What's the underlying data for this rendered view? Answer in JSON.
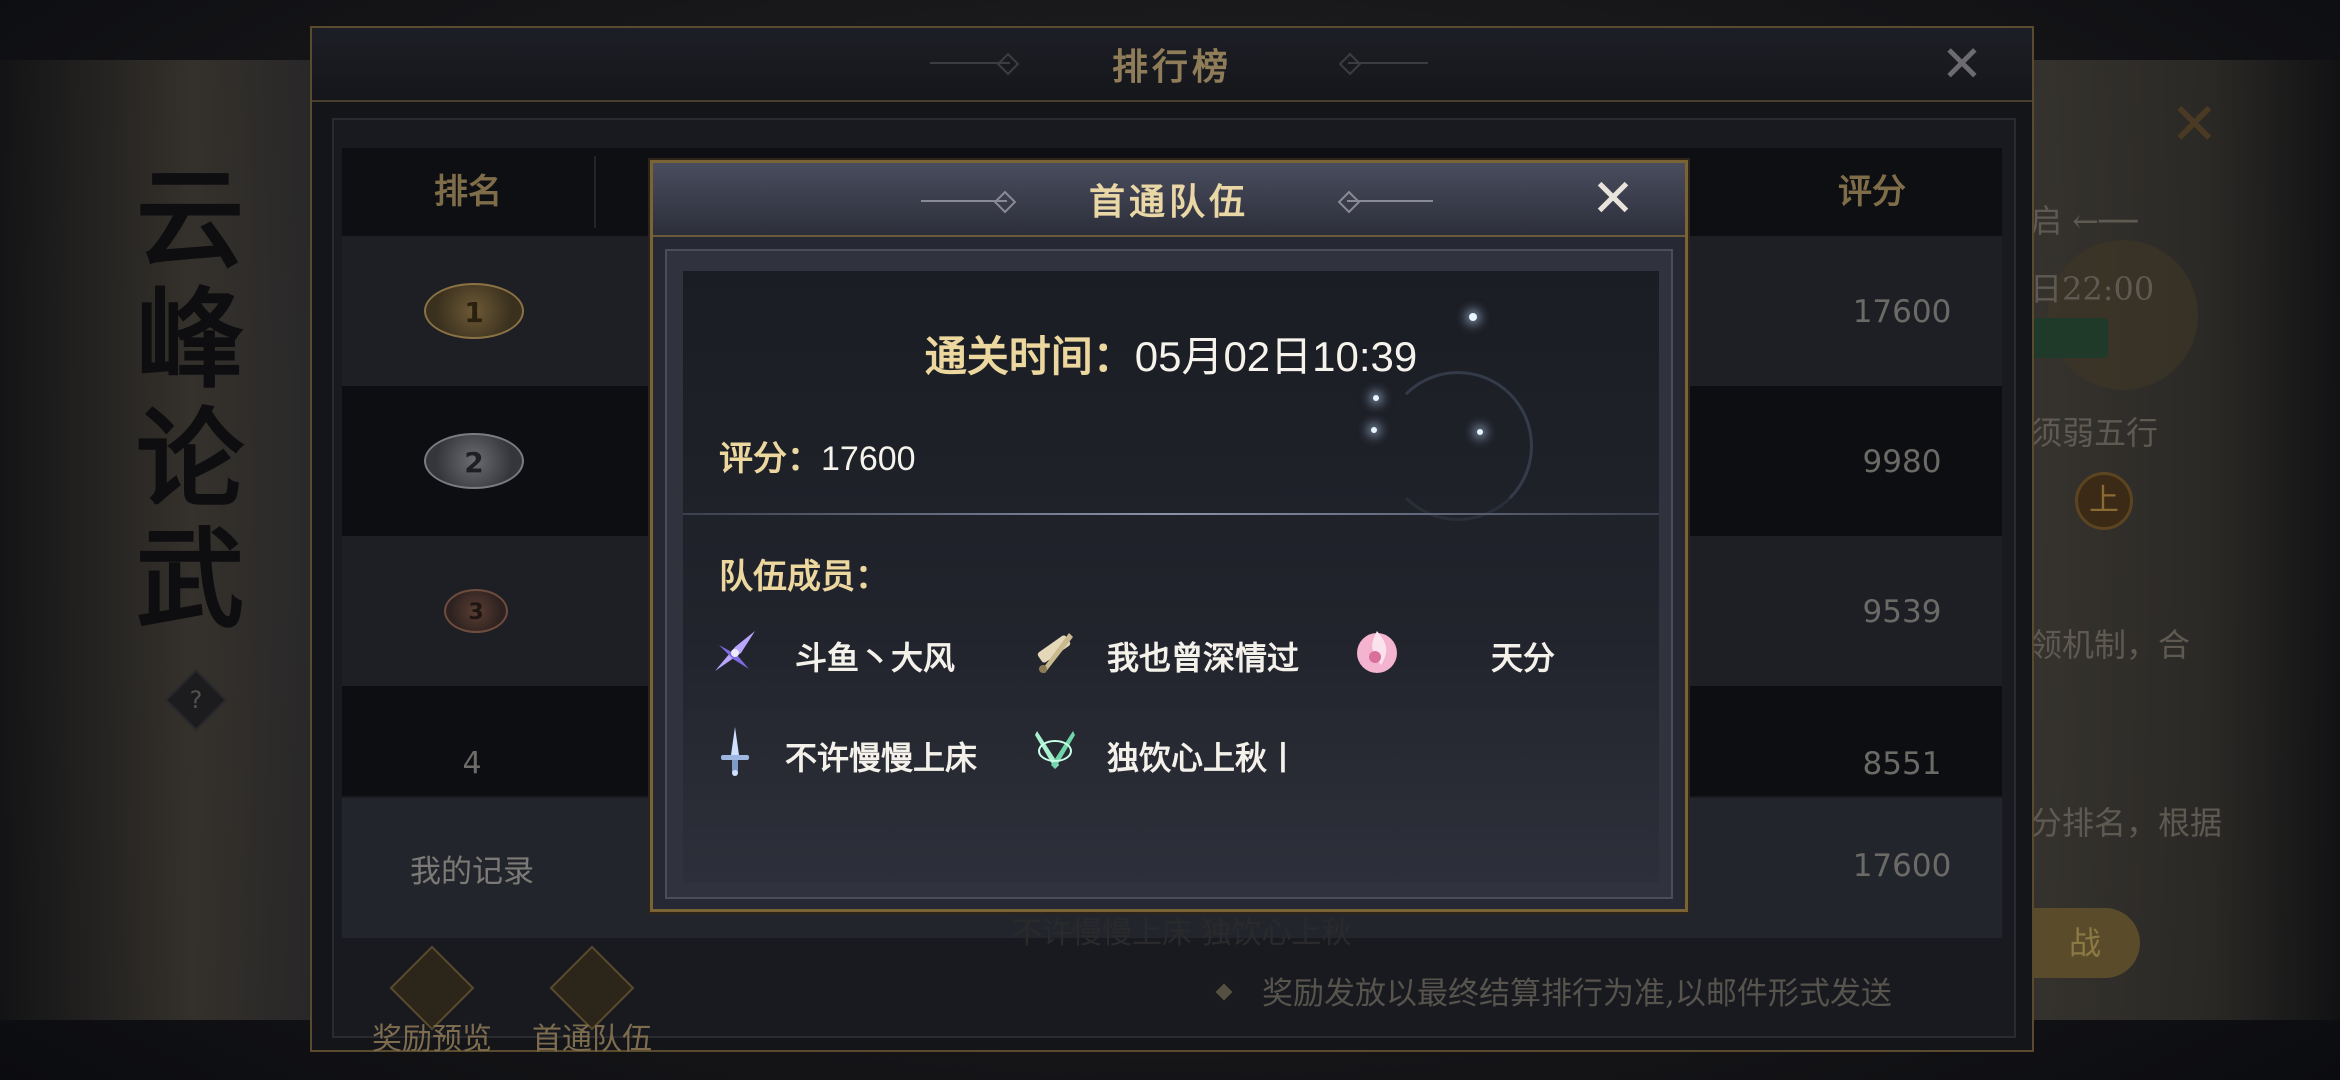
{
  "background": {
    "calligraphy": [
      "云",
      "峰",
      "论",
      "武"
    ],
    "help_label": "?",
    "close_label": "✕",
    "right_partial_texts": {
      "line1": "启 ←──",
      "line2": "日22:00",
      "line3": "须弱五行",
      "badge": "上",
      "line4": "领机制，合",
      "line5": "分排名，根据",
      "button": "战"
    }
  },
  "leaderboard": {
    "title": "排行榜",
    "close_label": "✕",
    "columns": {
      "rank": "排名",
      "score": "评分"
    },
    "rows": [
      {
        "rank": "1",
        "score": "17600"
      },
      {
        "rank": "2",
        "score": "9980"
      },
      {
        "rank": "3",
        "score": "9539"
      },
      {
        "rank": "4",
        "score": "8551"
      }
    ],
    "my_record": {
      "label": "我的记录",
      "score": "17600"
    },
    "tabs": {
      "reward_preview": "奖励预览",
      "first_clear_team": "首通队伍"
    },
    "notice": "奖励发放以最终结算排行为准,以邮件形式发送",
    "ghost_members": "不许慢慢上床        独饮心上秋"
  },
  "modal": {
    "title": "首通队伍",
    "close_label": "✕",
    "clear_time_label": "通关时间：",
    "clear_time_value": "05月02日10:39",
    "score_label": "评分：",
    "score_value": "17600",
    "members_label": "队伍成员：",
    "members": [
      {
        "name": "斗鱼丶大风",
        "icon": "purple-blade-class-icon"
      },
      {
        "name": "我也曾深情过",
        "icon": "scroll-brush-class-icon"
      },
      {
        "name": "天分",
        "icon": "pink-flame-class-icon"
      },
      {
        "name": "不许慢慢上床",
        "icon": "sword-class-icon"
      },
      {
        "name": "独饮心上秋丨",
        "icon": "green-dual-blade-class-icon"
      }
    ]
  },
  "colors": {
    "gold_text": "#ecd79f",
    "panel_border": "#7a6335",
    "modal_bg": "#262833"
  }
}
